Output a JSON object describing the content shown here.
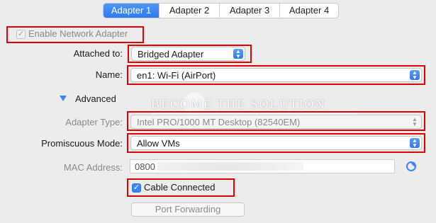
{
  "tabs": [
    {
      "label": "Adapter 1",
      "active": true
    },
    {
      "label": "Adapter 2",
      "active": false
    },
    {
      "label": "Adapter 3",
      "active": false
    },
    {
      "label": "Adapter 4",
      "active": false
    }
  ],
  "enable_adapter": {
    "label": "Enable Network Adapter",
    "checked": true,
    "enabled": false
  },
  "attached_to": {
    "label": "Attached to:",
    "value": "Bridged Adapter"
  },
  "name": {
    "label": "Name:",
    "value": "en1: Wi-Fi (AirPort)"
  },
  "advanced": {
    "label": "Advanced",
    "expanded": true
  },
  "adapter_type": {
    "label": "Adapter Type:",
    "value": "Intel PRO/1000 MT Desktop (82540EM)"
  },
  "promiscuous_mode": {
    "label": "Promiscuous Mode:",
    "value": "Allow VMs"
  },
  "mac_address": {
    "label": "MAC Address:",
    "value": "0800"
  },
  "cable_connected": {
    "label": "Cable Connected",
    "checked": true
  },
  "port_forwarding": {
    "label": "Port Forwarding"
  },
  "watermark": "BECOME THE SOLUTION",
  "colors": {
    "accent": "#3b86f7",
    "highlight": "#e00000",
    "background": "#ececec"
  },
  "icons": {
    "popup": "up-down-arrows-icon",
    "refresh": "refresh-icon",
    "check": "checkmark-icon",
    "disclosure": "disclosure-triangle-icon"
  }
}
